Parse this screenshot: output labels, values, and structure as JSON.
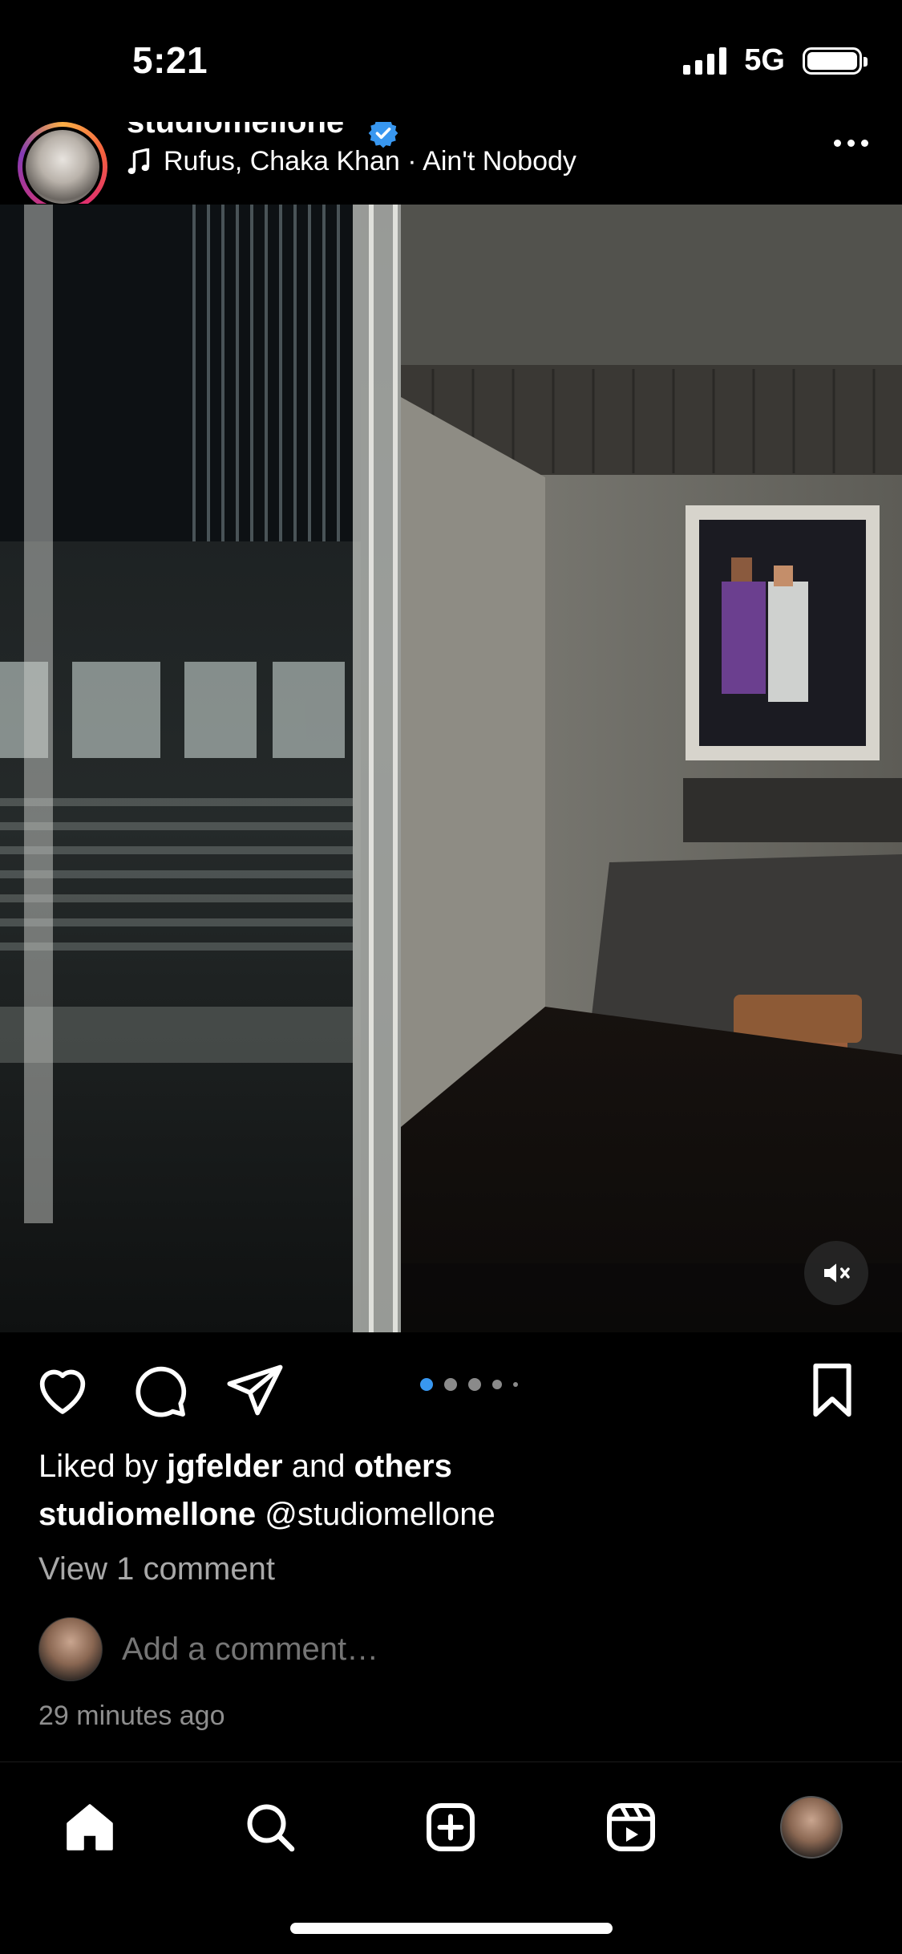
{
  "status_bar": {
    "time": "5:21",
    "network": "5G"
  },
  "post": {
    "username": "studiomellone",
    "verified": true,
    "song": "Rufus, Chaka Khan · Ain't Nobody",
    "carousel": {
      "count": 5,
      "active_index": 0
    },
    "liked_by_user": "jgfelder",
    "liked_by_middle": "and",
    "liked_by_others": "others",
    "caption_username": "studiomellone",
    "caption_text": "@studiomellone",
    "view_comments": "View 1 comment",
    "comment_placeholder": "Add a comment…",
    "timestamp": "29 minutes ago",
    "liked_prefix": "Liked by"
  },
  "icons": {
    "like": "heart-icon",
    "comment": "comment-icon",
    "share": "send-icon",
    "save": "bookmark-icon",
    "mute": "muted-speaker-icon",
    "more": "more-icon"
  },
  "tab_bar": {
    "items": [
      "home-icon",
      "search-icon",
      "new-post-icon",
      "reels-icon",
      "profile-avatar"
    ]
  },
  "colors": {
    "background": "#000000",
    "secondary_text": "#a8a8a8",
    "carousel_active": "#3897f0",
    "verified_badge": "#3897f0"
  }
}
